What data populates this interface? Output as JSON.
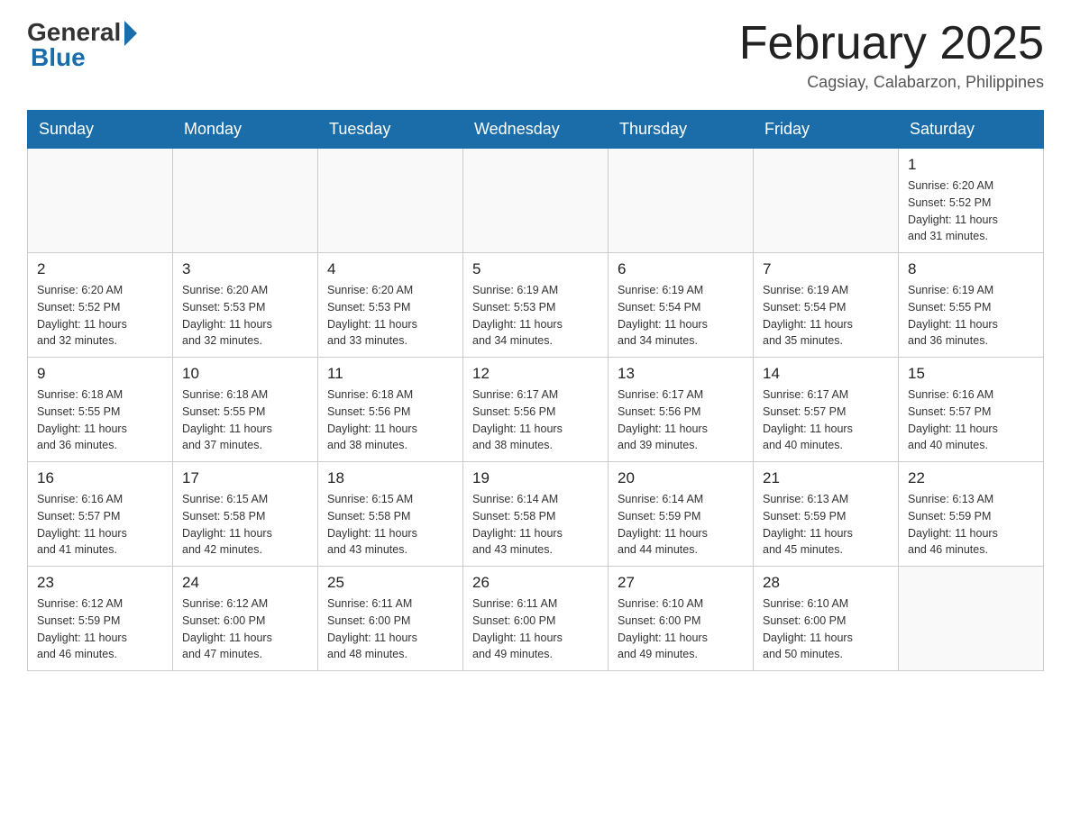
{
  "header": {
    "logo_general": "General",
    "logo_blue": "Blue",
    "title": "February 2025",
    "subtitle": "Cagsiay, Calabarzon, Philippines"
  },
  "weekdays": [
    "Sunday",
    "Monday",
    "Tuesday",
    "Wednesday",
    "Thursday",
    "Friday",
    "Saturday"
  ],
  "weeks": [
    [
      {
        "day": "",
        "info": ""
      },
      {
        "day": "",
        "info": ""
      },
      {
        "day": "",
        "info": ""
      },
      {
        "day": "",
        "info": ""
      },
      {
        "day": "",
        "info": ""
      },
      {
        "day": "",
        "info": ""
      },
      {
        "day": "1",
        "info": "Sunrise: 6:20 AM\nSunset: 5:52 PM\nDaylight: 11 hours\nand 31 minutes."
      }
    ],
    [
      {
        "day": "2",
        "info": "Sunrise: 6:20 AM\nSunset: 5:52 PM\nDaylight: 11 hours\nand 32 minutes."
      },
      {
        "day": "3",
        "info": "Sunrise: 6:20 AM\nSunset: 5:53 PM\nDaylight: 11 hours\nand 32 minutes."
      },
      {
        "day": "4",
        "info": "Sunrise: 6:20 AM\nSunset: 5:53 PM\nDaylight: 11 hours\nand 33 minutes."
      },
      {
        "day": "5",
        "info": "Sunrise: 6:19 AM\nSunset: 5:53 PM\nDaylight: 11 hours\nand 34 minutes."
      },
      {
        "day": "6",
        "info": "Sunrise: 6:19 AM\nSunset: 5:54 PM\nDaylight: 11 hours\nand 34 minutes."
      },
      {
        "day": "7",
        "info": "Sunrise: 6:19 AM\nSunset: 5:54 PM\nDaylight: 11 hours\nand 35 minutes."
      },
      {
        "day": "8",
        "info": "Sunrise: 6:19 AM\nSunset: 5:55 PM\nDaylight: 11 hours\nand 36 minutes."
      }
    ],
    [
      {
        "day": "9",
        "info": "Sunrise: 6:18 AM\nSunset: 5:55 PM\nDaylight: 11 hours\nand 36 minutes."
      },
      {
        "day": "10",
        "info": "Sunrise: 6:18 AM\nSunset: 5:55 PM\nDaylight: 11 hours\nand 37 minutes."
      },
      {
        "day": "11",
        "info": "Sunrise: 6:18 AM\nSunset: 5:56 PM\nDaylight: 11 hours\nand 38 minutes."
      },
      {
        "day": "12",
        "info": "Sunrise: 6:17 AM\nSunset: 5:56 PM\nDaylight: 11 hours\nand 38 minutes."
      },
      {
        "day": "13",
        "info": "Sunrise: 6:17 AM\nSunset: 5:56 PM\nDaylight: 11 hours\nand 39 minutes."
      },
      {
        "day": "14",
        "info": "Sunrise: 6:17 AM\nSunset: 5:57 PM\nDaylight: 11 hours\nand 40 minutes."
      },
      {
        "day": "15",
        "info": "Sunrise: 6:16 AM\nSunset: 5:57 PM\nDaylight: 11 hours\nand 40 minutes."
      }
    ],
    [
      {
        "day": "16",
        "info": "Sunrise: 6:16 AM\nSunset: 5:57 PM\nDaylight: 11 hours\nand 41 minutes."
      },
      {
        "day": "17",
        "info": "Sunrise: 6:15 AM\nSunset: 5:58 PM\nDaylight: 11 hours\nand 42 minutes."
      },
      {
        "day": "18",
        "info": "Sunrise: 6:15 AM\nSunset: 5:58 PM\nDaylight: 11 hours\nand 43 minutes."
      },
      {
        "day": "19",
        "info": "Sunrise: 6:14 AM\nSunset: 5:58 PM\nDaylight: 11 hours\nand 43 minutes."
      },
      {
        "day": "20",
        "info": "Sunrise: 6:14 AM\nSunset: 5:59 PM\nDaylight: 11 hours\nand 44 minutes."
      },
      {
        "day": "21",
        "info": "Sunrise: 6:13 AM\nSunset: 5:59 PM\nDaylight: 11 hours\nand 45 minutes."
      },
      {
        "day": "22",
        "info": "Sunrise: 6:13 AM\nSunset: 5:59 PM\nDaylight: 11 hours\nand 46 minutes."
      }
    ],
    [
      {
        "day": "23",
        "info": "Sunrise: 6:12 AM\nSunset: 5:59 PM\nDaylight: 11 hours\nand 46 minutes."
      },
      {
        "day": "24",
        "info": "Sunrise: 6:12 AM\nSunset: 6:00 PM\nDaylight: 11 hours\nand 47 minutes."
      },
      {
        "day": "25",
        "info": "Sunrise: 6:11 AM\nSunset: 6:00 PM\nDaylight: 11 hours\nand 48 minutes."
      },
      {
        "day": "26",
        "info": "Sunrise: 6:11 AM\nSunset: 6:00 PM\nDaylight: 11 hours\nand 49 minutes."
      },
      {
        "day": "27",
        "info": "Sunrise: 6:10 AM\nSunset: 6:00 PM\nDaylight: 11 hours\nand 49 minutes."
      },
      {
        "day": "28",
        "info": "Sunrise: 6:10 AM\nSunset: 6:00 PM\nDaylight: 11 hours\nand 50 minutes."
      },
      {
        "day": "",
        "info": ""
      }
    ]
  ]
}
